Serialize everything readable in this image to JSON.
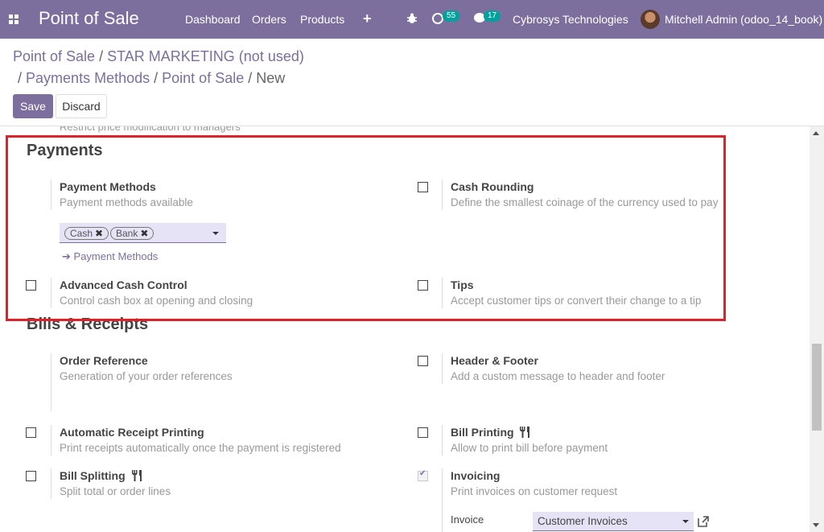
{
  "navbar": {
    "app_title": "Point of Sale",
    "menu": [
      "Dashboard",
      "Orders",
      "Products"
    ],
    "activity_count": "55",
    "messages_count": "17",
    "company": "Cybrosys Technologies",
    "user": "Mitchell Admin (odoo_14_book)"
  },
  "breadcrumb": {
    "line1": [
      "Point of Sale",
      "STAR MARKETING (not used)"
    ],
    "line2": [
      "Payments Methods",
      "Point of Sale"
    ],
    "current": "New",
    "separator": "/"
  },
  "actions": {
    "save": "Save",
    "discard": "Discard"
  },
  "cut_text": "Restrict price modification to managers",
  "sections": {
    "payments": {
      "title": "Payments",
      "payment_methods": {
        "title": "Payment Methods",
        "desc": "Payment methods available",
        "tags": [
          "Cash",
          "Bank"
        ],
        "link": "Payment Methods"
      },
      "cash_rounding": {
        "title": "Cash Rounding",
        "desc": "Define the smallest coinage of the currency used to pay",
        "checked": false
      },
      "advanced_cash": {
        "title": "Advanced Cash Control",
        "desc": "Control cash box at opening and closing",
        "checked": false
      },
      "tips": {
        "title": "Tips",
        "desc": "Accept customer tips or convert their change to a tip",
        "checked": false
      }
    },
    "bills": {
      "title": "Bills & Receipts",
      "order_ref": {
        "title": "Order Reference",
        "desc": "Generation of your order references"
      },
      "header_footer": {
        "title": "Header & Footer",
        "desc": "Add a custom message to header and footer",
        "checked": false
      },
      "auto_receipt": {
        "title": "Automatic Receipt Printing",
        "desc": "Print receipts automatically once the payment is registered",
        "checked": false
      },
      "bill_printing": {
        "title": "Bill Printing",
        "desc": "Allow to print bill before payment",
        "checked": false
      },
      "bill_splitting": {
        "title": "Bill Splitting",
        "desc": "Split total or order lines",
        "checked": false
      },
      "invoicing": {
        "title": "Invoicing",
        "desc": "Print invoices on customer request",
        "checked": true,
        "invoice_label": "Invoice",
        "invoice_value": "Customer Invoices"
      }
    }
  },
  "colors": {
    "brand": "#7c6f9e",
    "highlight_box": "#e1202a",
    "badge": "#00a09d"
  }
}
